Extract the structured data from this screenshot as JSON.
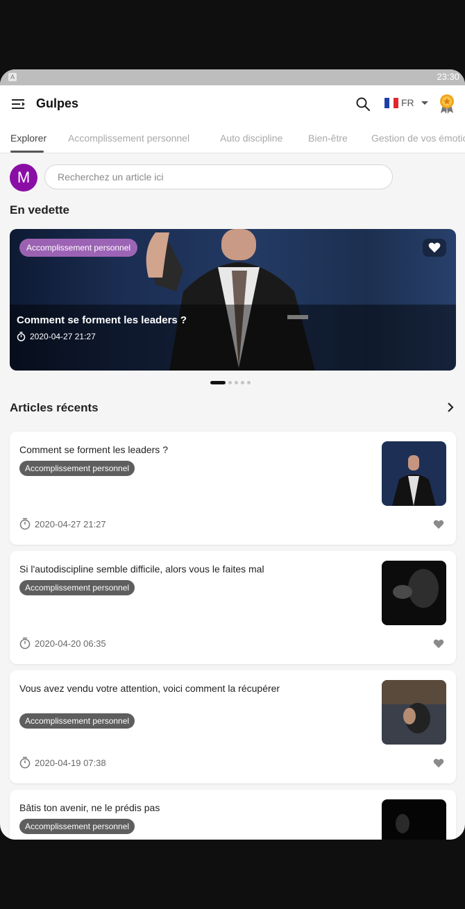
{
  "status_bar": {
    "app_icon": "A",
    "time": "23:30"
  },
  "app": {
    "title": "Gulpes",
    "language_code": "FR",
    "flag": "france-flag",
    "badge": "award-badge-icon"
  },
  "tabs": [
    {
      "label": "Explorer",
      "active": true
    },
    {
      "label": "Accomplissement personnel",
      "active": false
    },
    {
      "label": "Auto discipline",
      "active": false
    },
    {
      "label": "Bien-être",
      "active": false
    },
    {
      "label": "Gestion de vos émotions",
      "active": false
    }
  ],
  "user": {
    "avatar_letter": "M",
    "avatar_color": "#8a0ea6"
  },
  "search": {
    "placeholder": "Recherchez un article ici"
  },
  "featured": {
    "section_title": "En vedette",
    "tag": "Accomplissement personnel",
    "title": "Comment se forment les leaders ?",
    "date": "2020-04-27 21:27",
    "carousel_count": 5,
    "carousel_active": 0
  },
  "recent": {
    "section_title": "Articles récents",
    "articles": [
      {
        "title": "Comment se forment les leaders ?",
        "tag": "Accomplissement personnel",
        "date": "2020-04-27 21:27"
      },
      {
        "title": "Si l'autodiscipline semble difficile, alors vous le faites mal",
        "tag": "Accomplissement personnel",
        "date": "2020-04-20 06:35"
      },
      {
        "title": "Vous avez vendu votre attention, voici comment la récupérer",
        "tag": "Accomplissement personnel",
        "date": "2020-04-19 07:38"
      },
      {
        "title": "Bâtis ton avenir, ne le prédis pas",
        "tag": "Accomplissement personnel",
        "date": ""
      }
    ]
  }
}
